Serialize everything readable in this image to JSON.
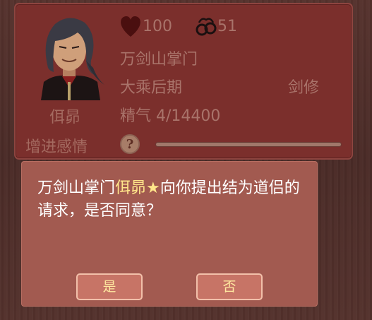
{
  "character": {
    "name": "佴昴",
    "hp": "100",
    "ring": "51",
    "title": "万剑山掌门",
    "rank": "大乘后期",
    "class": "剑修",
    "energy_label": "精气",
    "energy": "4/14400",
    "bond_label": "增进感情",
    "help": "?",
    "bond_progress": 0.0
  },
  "dialog": {
    "prefix": "万剑山掌门",
    "name": "佴昴",
    "star": "★",
    "message": "向你提出结为道侣的请求，是否同意？",
    "yes": "是",
    "no": "否"
  },
  "icons": {
    "hp": "heart-icon",
    "ring": "ring-icon"
  },
  "colors": {
    "panel": "#7b2f2c",
    "dialog": "#a25a50",
    "highlight": "#ffe58a",
    "button": "#c77466"
  }
}
